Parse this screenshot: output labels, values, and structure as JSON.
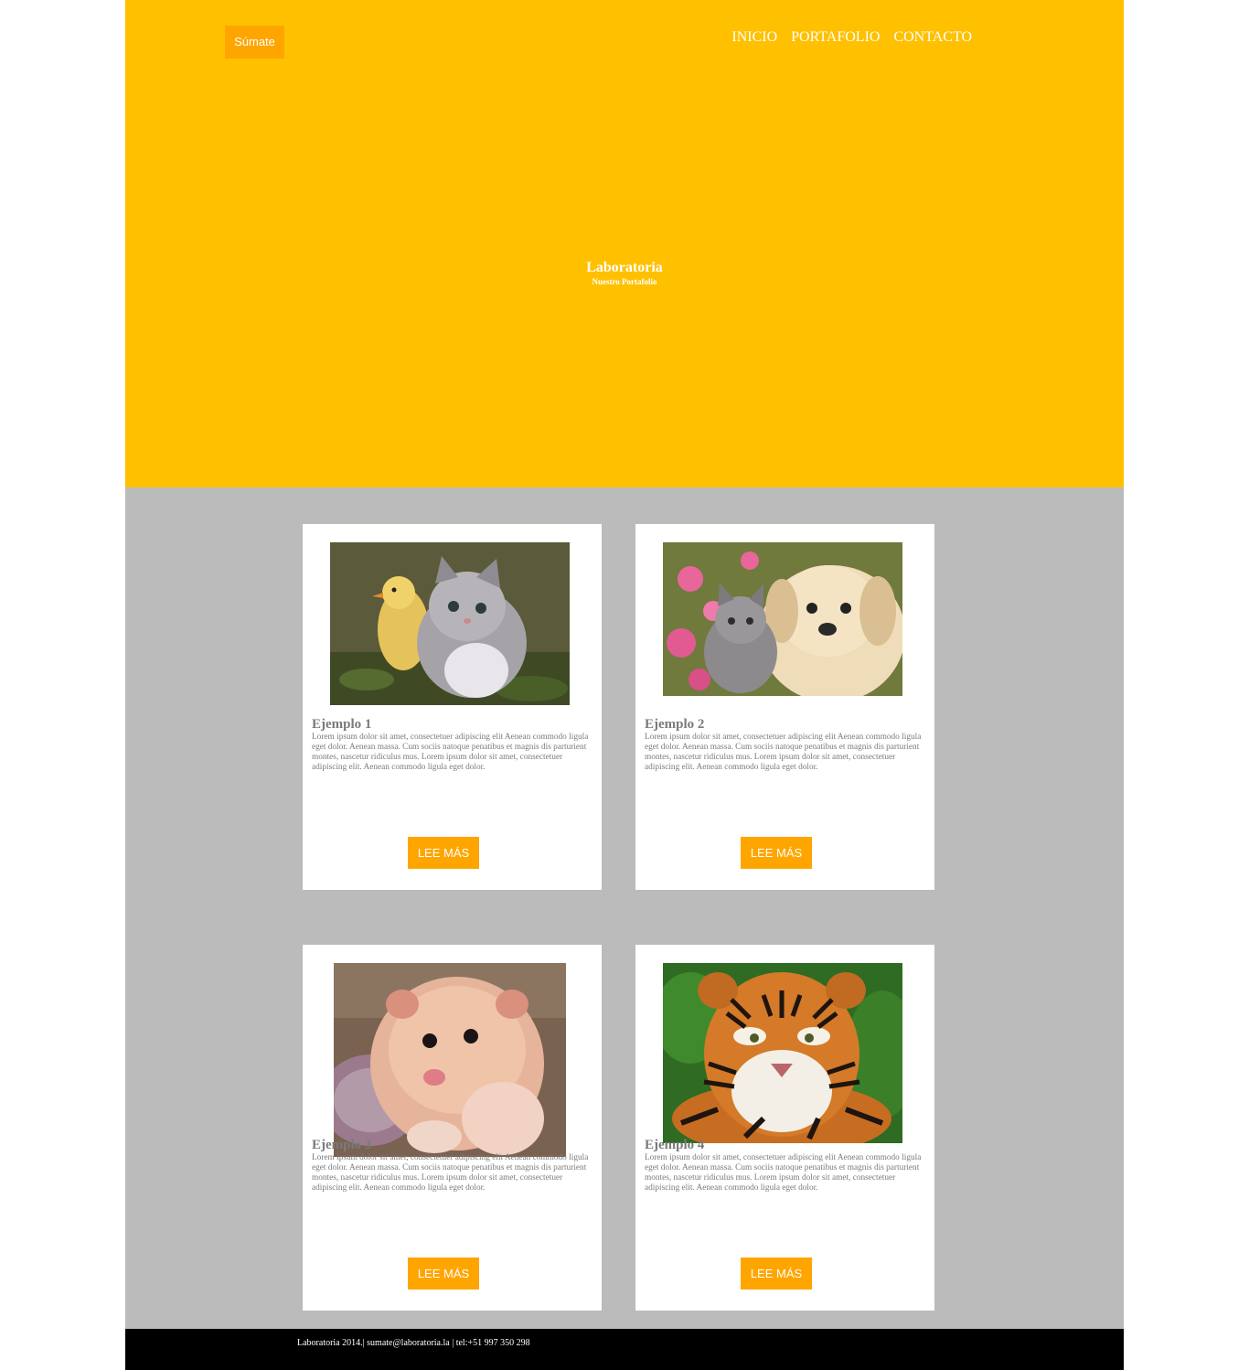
{
  "header": {
    "join_label": "Súmate",
    "nav": [
      {
        "label": "INICIO"
      },
      {
        "label": "PORTAFOLIO"
      },
      {
        "label": "CONTACTO"
      }
    ],
    "title": "Laboratoria",
    "subtitle": "Nuestro Portafolio"
  },
  "cards": [
    {
      "title": "Ejemplo 1",
      "body": "Lorem ipsum dolor sit amet, consectetuer adipiscing elit Aenean commodo ligula eget dolor. Aenean massa. Cum sociis natoque penatibus et magnis dis parturient montes, nascetur ridiculus mus. Lorem ipsum dolor sit amet, consectetuer adipiscing elit. Aenean commodo ligula eget dolor.",
      "button": "LEE MÁS",
      "image": "kitten-and-chick-photo"
    },
    {
      "title": "Ejemplo 2",
      "body": "Lorem ipsum dolor sit amet, consectetuer adipiscing elit Aenean commodo ligula eget dolor. Aenean massa. Cum sociis natoque penatibus et magnis dis parturient montes, nascetur ridiculus mus. Lorem ipsum dolor sit amet, consectetuer adipiscing elit. Aenean commodo ligula eget dolor.",
      "button": "LEE MÁS",
      "image": "kitten-and-puppy-photo"
    },
    {
      "title": "Ejemplo 3",
      "body": "Lorem ipsum dolor sit amet, consectetuer adipiscing elit Aenean commodo ligula eget dolor. Aenean massa. Cum sociis natoque penatibus et magnis dis parturient montes, nascetur ridiculus mus. Lorem ipsum dolor sit amet, consectetuer adipiscing elit. Aenean commodo ligula eget dolor.",
      "button": "LEE MÁS",
      "image": "hamster-photo"
    },
    {
      "title": "Ejemplo 4",
      "body": "Lorem ipsum dolor sit amet, consectetuer adipiscing elit Aenean commodo ligula eget dolor. Aenean massa. Cum sociis natoque penatibus et magnis dis parturient montes, nascetur ridiculus mus. Lorem ipsum dolor sit amet, consectetuer adipiscing elit. Aenean commodo ligula eget dolor.",
      "button": "LEE MÁS",
      "image": "tiger-photo"
    }
  ],
  "footer": {
    "text": "Laboratoria 2014.| sumate@laboratoria.la | tel:+51 997 350 298"
  },
  "colors": {
    "hero_bg": "#ffc000",
    "accent": "#ffa500",
    "grid_bg": "#bbbbbb",
    "footer_bg": "#000000",
    "card_text": "#7a7a7a"
  }
}
